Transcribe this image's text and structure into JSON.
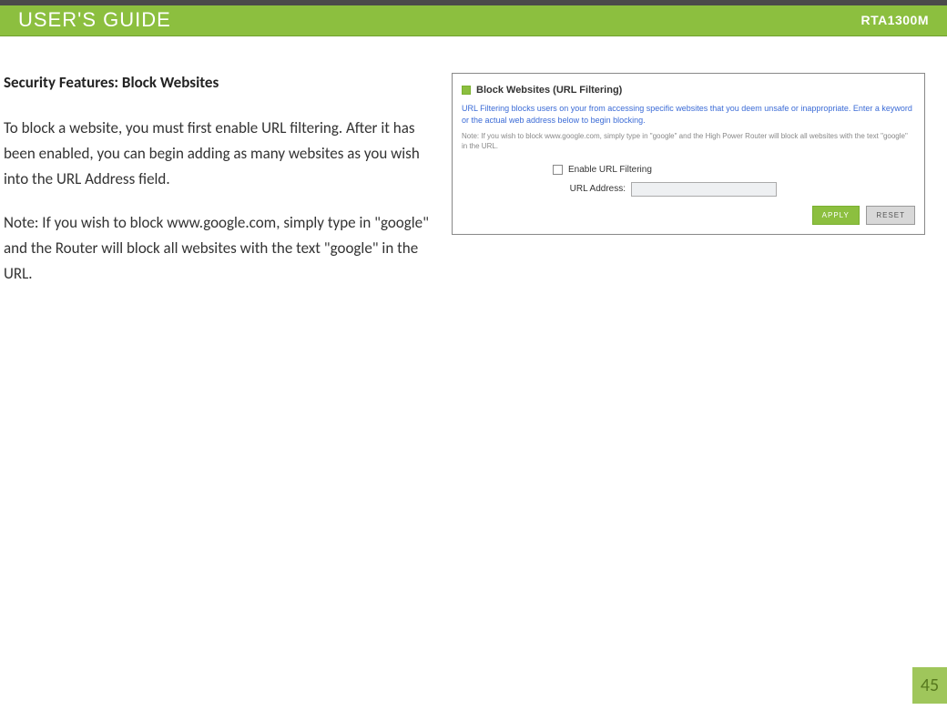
{
  "header": {
    "title": "USER'S GUIDE",
    "model": "RTA1300M"
  },
  "section": {
    "heading": "Security Features: Block Websites",
    "p1": "To block a website, you must first enable URL filtering. After it has been enabled, you can begin adding as many websites as you wish into the URL Address field.",
    "p2": "Note:  If you wish to block www.google.com, simply type in \"google\" and the Router will block all websites with the text \"google\" in the URL."
  },
  "panel": {
    "title": "Block Websites (URL Filtering)",
    "desc": "URL Filtering blocks users on your from accessing specific websites that you deem unsafe or inappropriate. Enter a keyword or the actual web address below to begin blocking.",
    "note": "Note: If you wish to block www.google.com, simply type in \"google\" and the High Power Router will block all websites with the text \"google\" in the URL.",
    "enable_label": "Enable URL Filtering",
    "url_label": "URL Address:",
    "url_value": "",
    "apply": "APPLY",
    "reset": "RESET"
  },
  "page_number": "45"
}
